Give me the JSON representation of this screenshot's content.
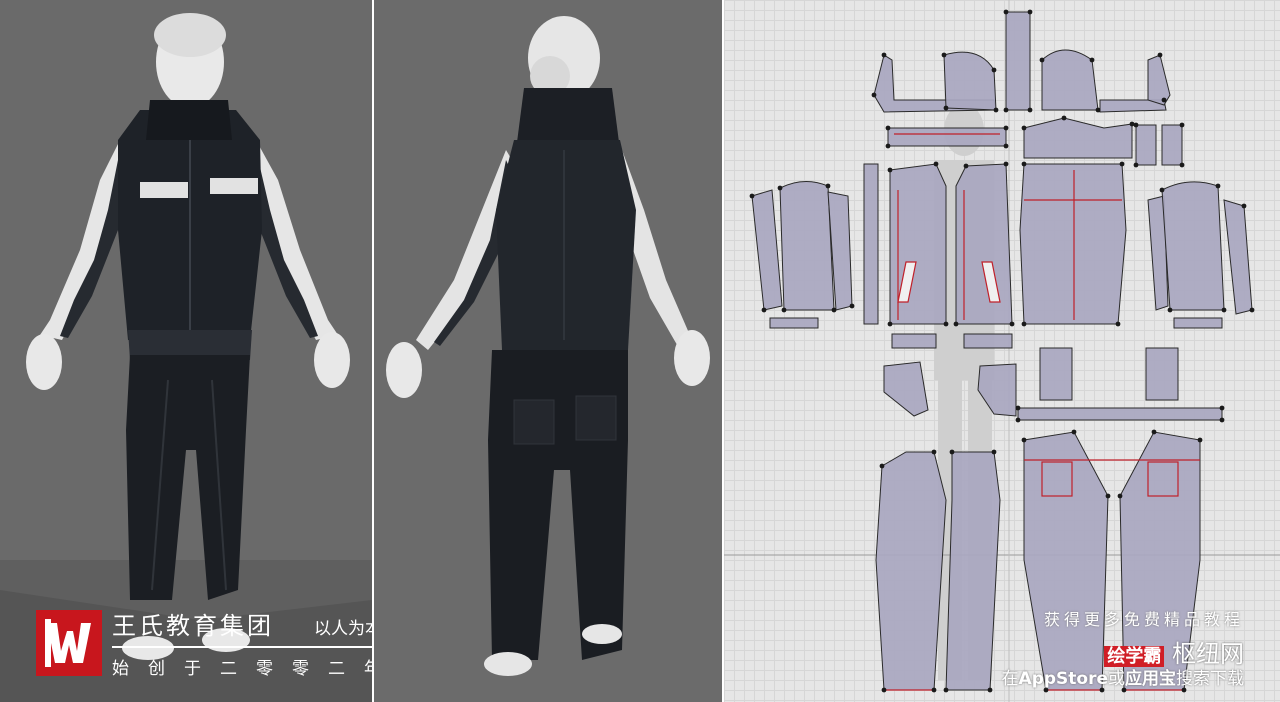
{
  "views": {
    "front": {
      "background": "#6a6a6a"
    },
    "back": {
      "background": "#6b6b6b"
    },
    "pattern": {
      "background": "#e6e6e6",
      "piece_fill": "#a9a7c0",
      "seam_color": "#c0202a"
    }
  },
  "brand": {
    "name": "王氏教育集团",
    "slogan": "以人为本",
    "founded": "始创于二零零二年",
    "logo_color": "#c8161d"
  },
  "promo": {
    "line1": "获得更多免费精品教程",
    "app_name": "绘学霸",
    "site": "枢纽网",
    "line3_prefix": "在",
    "line3_store1": "AppStore",
    "line3_or": "或",
    "line3_store2": "应用宝",
    "line3_suffix": "搜索下载"
  }
}
